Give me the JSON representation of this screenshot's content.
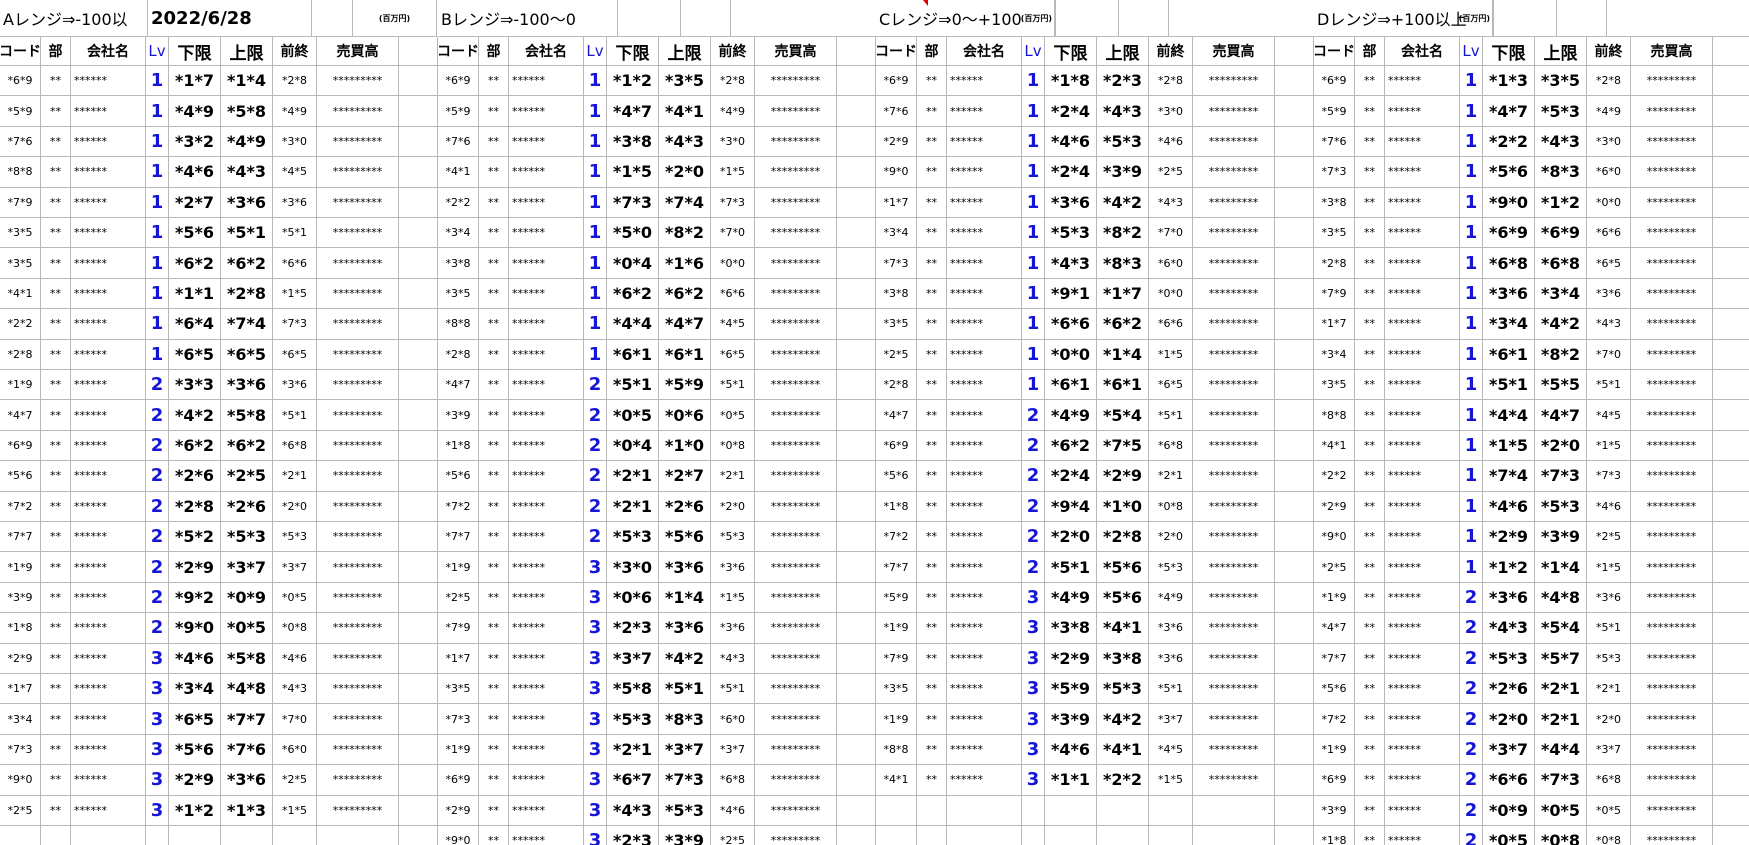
{
  "date": "2022/6/28",
  "unit_label": "(百万円)",
  "headers": [
    "コード",
    "部",
    "会社名",
    "Lv",
    "下限",
    "上限",
    "前終",
    "売買高"
  ],
  "sections": [
    {
      "title": "Aレンジ⇒-100以",
      "rows": [
        [
          "*6*9",
          "**",
          "******",
          "1",
          "*1*7",
          "*1*4",
          "*2*8",
          "*********"
        ],
        [
          "*5*9",
          "**",
          "******",
          "1",
          "*4*9",
          "*5*8",
          "*4*9",
          "*********"
        ],
        [
          "*7*6",
          "**",
          "******",
          "1",
          "*3*2",
          "*4*9",
          "*3*0",
          "*********"
        ],
        [
          "*8*8",
          "**",
          "******",
          "1",
          "*4*6",
          "*4*3",
          "*4*5",
          "*********"
        ],
        [
          "*7*9",
          "**",
          "******",
          "1",
          "*2*7",
          "*3*6",
          "*3*6",
          "*********"
        ],
        [
          "*3*5",
          "**",
          "******",
          "1",
          "*5*6",
          "*5*1",
          "*5*1",
          "*********"
        ],
        [
          "*3*5",
          "**",
          "******",
          "1",
          "*6*2",
          "*6*2",
          "*6*6",
          "*********"
        ],
        [
          "*4*1",
          "**",
          "******",
          "1",
          "*1*1",
          "*2*8",
          "*1*5",
          "*********"
        ],
        [
          "*2*2",
          "**",
          "******",
          "1",
          "*6*4",
          "*7*4",
          "*7*3",
          "*********"
        ],
        [
          "*2*8",
          "**",
          "******",
          "1",
          "*6*5",
          "*6*5",
          "*6*5",
          "*********"
        ],
        [
          "*1*9",
          "**",
          "******",
          "2",
          "*3*3",
          "*3*6",
          "*3*6",
          "*********"
        ],
        [
          "*4*7",
          "**",
          "******",
          "2",
          "*4*2",
          "*5*8",
          "*5*1",
          "*********"
        ],
        [
          "*6*9",
          "**",
          "******",
          "2",
          "*6*2",
          "*6*2",
          "*6*8",
          "*********"
        ],
        [
          "*5*6",
          "**",
          "******",
          "2",
          "*2*6",
          "*2*5",
          "*2*1",
          "*********"
        ],
        [
          "*7*2",
          "**",
          "******",
          "2",
          "*2*8",
          "*2*6",
          "*2*0",
          "*********"
        ],
        [
          "*7*7",
          "**",
          "******",
          "2",
          "*5*2",
          "*5*3",
          "*5*3",
          "*********"
        ],
        [
          "*1*9",
          "**",
          "******",
          "2",
          "*2*9",
          "*3*7",
          "*3*7",
          "*********"
        ],
        [
          "*3*9",
          "**",
          "******",
          "2",
          "*9*2",
          "*0*9",
          "*0*5",
          "*********"
        ],
        [
          "*1*8",
          "**",
          "******",
          "2",
          "*9*0",
          "*0*5",
          "*0*8",
          "*********"
        ],
        [
          "*2*9",
          "**",
          "******",
          "3",
          "*4*6",
          "*5*8",
          "*4*6",
          "*********"
        ],
        [
          "*1*7",
          "**",
          "******",
          "3",
          "*3*4",
          "*4*8",
          "*4*3",
          "*********"
        ],
        [
          "*3*4",
          "**",
          "******",
          "3",
          "*6*5",
          "*7*7",
          "*7*0",
          "*********"
        ],
        [
          "*7*3",
          "**",
          "******",
          "3",
          "*5*6",
          "*7*6",
          "*6*0",
          "*********"
        ],
        [
          "*9*0",
          "**",
          "******",
          "3",
          "*2*9",
          "*3*6",
          "*2*5",
          "*********"
        ],
        [
          "*2*5",
          "**",
          "******",
          "3",
          "*1*2",
          "*1*3",
          "*1*5",
          "*********"
        ],
        [
          "",
          "",
          "",
          "",
          "",
          "",
          "",
          ""
        ]
      ]
    },
    {
      "title": "Bレンジ⇒-100〜0",
      "rows": [
        [
          "*6*9",
          "**",
          "******",
          "1",
          "*1*2",
          "*3*5",
          "*2*8",
          "*********"
        ],
        [
          "*5*9",
          "**",
          "******",
          "1",
          "*4*7",
          "*4*1",
          "*4*9",
          "*********"
        ],
        [
          "*7*6",
          "**",
          "******",
          "1",
          "*3*8",
          "*4*3",
          "*3*0",
          "*********"
        ],
        [
          "*4*1",
          "**",
          "******",
          "1",
          "*1*5",
          "*2*0",
          "*1*5",
          "*********"
        ],
        [
          "*2*2",
          "**",
          "******",
          "1",
          "*7*3",
          "*7*4",
          "*7*3",
          "*********"
        ],
        [
          "*3*4",
          "**",
          "******",
          "1",
          "*5*0",
          "*8*2",
          "*7*0",
          "*********"
        ],
        [
          "*3*8",
          "**",
          "******",
          "1",
          "*0*4",
          "*1*6",
          "*0*0",
          "*********"
        ],
        [
          "*3*5",
          "**",
          "******",
          "1",
          "*6*2",
          "*6*2",
          "*6*6",
          "*********"
        ],
        [
          "*8*8",
          "**",
          "******",
          "1",
          "*4*4",
          "*4*7",
          "*4*5",
          "*********"
        ],
        [
          "*2*8",
          "**",
          "******",
          "1",
          "*6*1",
          "*6*1",
          "*6*5",
          "*********"
        ],
        [
          "*4*7",
          "**",
          "******",
          "2",
          "*5*1",
          "*5*9",
          "*5*1",
          "*********"
        ],
        [
          "*3*9",
          "**",
          "******",
          "2",
          "*0*5",
          "*0*6",
          "*0*5",
          "*********"
        ],
        [
          "*1*8",
          "**",
          "******",
          "2",
          "*0*4",
          "*1*0",
          "*0*8",
          "*********"
        ],
        [
          "*5*6",
          "**",
          "******",
          "2",
          "*2*1",
          "*2*7",
          "*2*1",
          "*********"
        ],
        [
          "*7*2",
          "**",
          "******",
          "2",
          "*2*1",
          "*2*6",
          "*2*0",
          "*********"
        ],
        [
          "*7*7",
          "**",
          "******",
          "2",
          "*5*3",
          "*5*6",
          "*5*3",
          "*********"
        ],
        [
          "*1*9",
          "**",
          "******",
          "3",
          "*3*0",
          "*3*6",
          "*3*6",
          "*********"
        ],
        [
          "*2*5",
          "**",
          "******",
          "3",
          "*0*6",
          "*1*4",
          "*1*5",
          "*********"
        ],
        [
          "*7*9",
          "**",
          "******",
          "3",
          "*2*3",
          "*3*6",
          "*3*6",
          "*********"
        ],
        [
          "*1*7",
          "**",
          "******",
          "3",
          "*3*7",
          "*4*2",
          "*4*3",
          "*********"
        ],
        [
          "*3*5",
          "**",
          "******",
          "3",
          "*5*8",
          "*5*1",
          "*5*1",
          "*********"
        ],
        [
          "*7*3",
          "**",
          "******",
          "3",
          "*5*3",
          "*8*3",
          "*6*0",
          "*********"
        ],
        [
          "*1*9",
          "**",
          "******",
          "3",
          "*2*1",
          "*3*7",
          "*3*7",
          "*********"
        ],
        [
          "*6*9",
          "**",
          "******",
          "3",
          "*6*7",
          "*7*3",
          "*6*8",
          "*********"
        ],
        [
          "*2*9",
          "**",
          "******",
          "3",
          "*4*3",
          "*5*3",
          "*4*6",
          "*********"
        ],
        [
          "*9*0",
          "**",
          "******",
          "3",
          "*2*3",
          "*3*9",
          "*2*5",
          "*********"
        ]
      ]
    },
    {
      "title": "Cレンジ⇒0〜+100",
      "rows": [
        [
          "*6*9",
          "**",
          "******",
          "1",
          "*1*8",
          "*2*3",
          "*2*8",
          "*********"
        ],
        [
          "*7*6",
          "**",
          "******",
          "1",
          "*2*4",
          "*4*3",
          "*3*0",
          "*********"
        ],
        [
          "*2*9",
          "**",
          "******",
          "1",
          "*4*6",
          "*5*3",
          "*4*6",
          "*********"
        ],
        [
          "*9*0",
          "**",
          "******",
          "1",
          "*2*4",
          "*3*9",
          "*2*5",
          "*********"
        ],
        [
          "*1*7",
          "**",
          "******",
          "1",
          "*3*6",
          "*4*2",
          "*4*3",
          "*********"
        ],
        [
          "*3*4",
          "**",
          "******",
          "1",
          "*5*3",
          "*8*2",
          "*7*0",
          "*********"
        ],
        [
          "*7*3",
          "**",
          "******",
          "1",
          "*4*3",
          "*8*3",
          "*6*0",
          "*********"
        ],
        [
          "*3*8",
          "**",
          "******",
          "1",
          "*9*1",
          "*1*7",
          "*0*0",
          "*********"
        ],
        [
          "*3*5",
          "**",
          "******",
          "1",
          "*6*6",
          "*6*2",
          "*6*6",
          "*********"
        ],
        [
          "*2*5",
          "**",
          "******",
          "1",
          "*0*0",
          "*1*4",
          "*1*5",
          "*********"
        ],
        [
          "*2*8",
          "**",
          "******",
          "1",
          "*6*1",
          "*6*1",
          "*6*5",
          "*********"
        ],
        [
          "*4*7",
          "**",
          "******",
          "2",
          "*4*9",
          "*5*4",
          "*5*1",
          "*********"
        ],
        [
          "*6*9",
          "**",
          "******",
          "2",
          "*6*2",
          "*7*5",
          "*6*8",
          "*********"
        ],
        [
          "*5*6",
          "**",
          "******",
          "2",
          "*2*4",
          "*2*9",
          "*2*1",
          "*********"
        ],
        [
          "*1*8",
          "**",
          "******",
          "2",
          "*9*4",
          "*1*0",
          "*0*8",
          "*********"
        ],
        [
          "*7*2",
          "**",
          "******",
          "2",
          "*2*0",
          "*2*8",
          "*2*0",
          "*********"
        ],
        [
          "*7*7",
          "**",
          "******",
          "2",
          "*5*1",
          "*5*6",
          "*5*3",
          "*********"
        ],
        [
          "*5*9",
          "**",
          "******",
          "3",
          "*4*9",
          "*5*6",
          "*4*9",
          "*********"
        ],
        [
          "*1*9",
          "**",
          "******",
          "3",
          "*3*8",
          "*4*1",
          "*3*6",
          "*********"
        ],
        [
          "*7*9",
          "**",
          "******",
          "3",
          "*2*9",
          "*3*8",
          "*3*6",
          "*********"
        ],
        [
          "*3*5",
          "**",
          "******",
          "3",
          "*5*9",
          "*5*3",
          "*5*1",
          "*********"
        ],
        [
          "*1*9",
          "**",
          "******",
          "3",
          "*3*9",
          "*4*2",
          "*3*7",
          "*********"
        ],
        [
          "*8*8",
          "**",
          "******",
          "3",
          "*4*6",
          "*4*1",
          "*4*5",
          "*********"
        ],
        [
          "*4*1",
          "**",
          "******",
          "3",
          "*1*1",
          "*2*2",
          "*1*5",
          "*********"
        ],
        [
          "",
          "",
          "",
          "",
          "",
          "",
          "",
          ""
        ],
        [
          "",
          "",
          "",
          "",
          "",
          "",
          "",
          ""
        ]
      ]
    },
    {
      "title": "Dレンジ⇒+100以上",
      "rows": [
        [
          "*6*9",
          "**",
          "******",
          "1",
          "*1*3",
          "*3*5",
          "*2*8",
          "*********"
        ],
        [
          "*5*9",
          "**",
          "******",
          "1",
          "*4*7",
          "*5*3",
          "*4*9",
          "*********"
        ],
        [
          "*7*6",
          "**",
          "******",
          "1",
          "*2*2",
          "*4*3",
          "*3*0",
          "*********"
        ],
        [
          "*7*3",
          "**",
          "******",
          "1",
          "*5*6",
          "*8*3",
          "*6*0",
          "*********"
        ],
        [
          "*3*8",
          "**",
          "******",
          "1",
          "*9*0",
          "*1*2",
          "*0*0",
          "*********"
        ],
        [
          "*3*5",
          "**",
          "******",
          "1",
          "*6*9",
          "*6*9",
          "*6*6",
          "*********"
        ],
        [
          "*2*8",
          "**",
          "******",
          "1",
          "*6*8",
          "*6*8",
          "*6*5",
          "*********"
        ],
        [
          "*7*9",
          "**",
          "******",
          "1",
          "*3*6",
          "*3*4",
          "*3*6",
          "*********"
        ],
        [
          "*1*7",
          "**",
          "******",
          "1",
          "*3*4",
          "*4*2",
          "*4*3",
          "*********"
        ],
        [
          "*3*4",
          "**",
          "******",
          "1",
          "*6*1",
          "*8*2",
          "*7*0",
          "*********"
        ],
        [
          "*3*5",
          "**",
          "******",
          "1",
          "*5*1",
          "*5*5",
          "*5*1",
          "*********"
        ],
        [
          "*8*8",
          "**",
          "******",
          "1",
          "*4*4",
          "*4*7",
          "*4*5",
          "*********"
        ],
        [
          "*4*1",
          "**",
          "******",
          "1",
          "*1*5",
          "*2*0",
          "*1*5",
          "*********"
        ],
        [
          "*2*2",
          "**",
          "******",
          "1",
          "*7*4",
          "*7*3",
          "*7*3",
          "*********"
        ],
        [
          "*2*9",
          "**",
          "******",
          "1",
          "*4*6",
          "*5*3",
          "*4*6",
          "*********"
        ],
        [
          "*9*0",
          "**",
          "******",
          "1",
          "*2*9",
          "*3*9",
          "*2*5",
          "*********"
        ],
        [
          "*2*5",
          "**",
          "******",
          "1",
          "*1*2",
          "*1*4",
          "*1*5",
          "*********"
        ],
        [
          "*1*9",
          "**",
          "******",
          "2",
          "*3*6",
          "*4*8",
          "*3*6",
          "*********"
        ],
        [
          "*4*7",
          "**",
          "******",
          "2",
          "*4*3",
          "*5*4",
          "*5*1",
          "*********"
        ],
        [
          "*7*7",
          "**",
          "******",
          "2",
          "*5*3",
          "*5*7",
          "*5*3",
          "*********"
        ],
        [
          "*5*6",
          "**",
          "******",
          "2",
          "*2*6",
          "*2*1",
          "*2*1",
          "*********"
        ],
        [
          "*7*2",
          "**",
          "******",
          "2",
          "*2*0",
          "*2*1",
          "*2*0",
          "*********"
        ],
        [
          "*1*9",
          "**",
          "******",
          "2",
          "*3*7",
          "*4*4",
          "*3*7",
          "*********"
        ],
        [
          "*6*9",
          "**",
          "******",
          "2",
          "*6*6",
          "*7*3",
          "*6*8",
          "*********"
        ],
        [
          "*3*9",
          "**",
          "******",
          "2",
          "*0*9",
          "*0*5",
          "*0*5",
          "*********"
        ],
        [
          "*1*8",
          "**",
          "******",
          "2",
          "*0*5",
          "*0*8",
          "*0*8",
          "*********"
        ]
      ]
    }
  ]
}
